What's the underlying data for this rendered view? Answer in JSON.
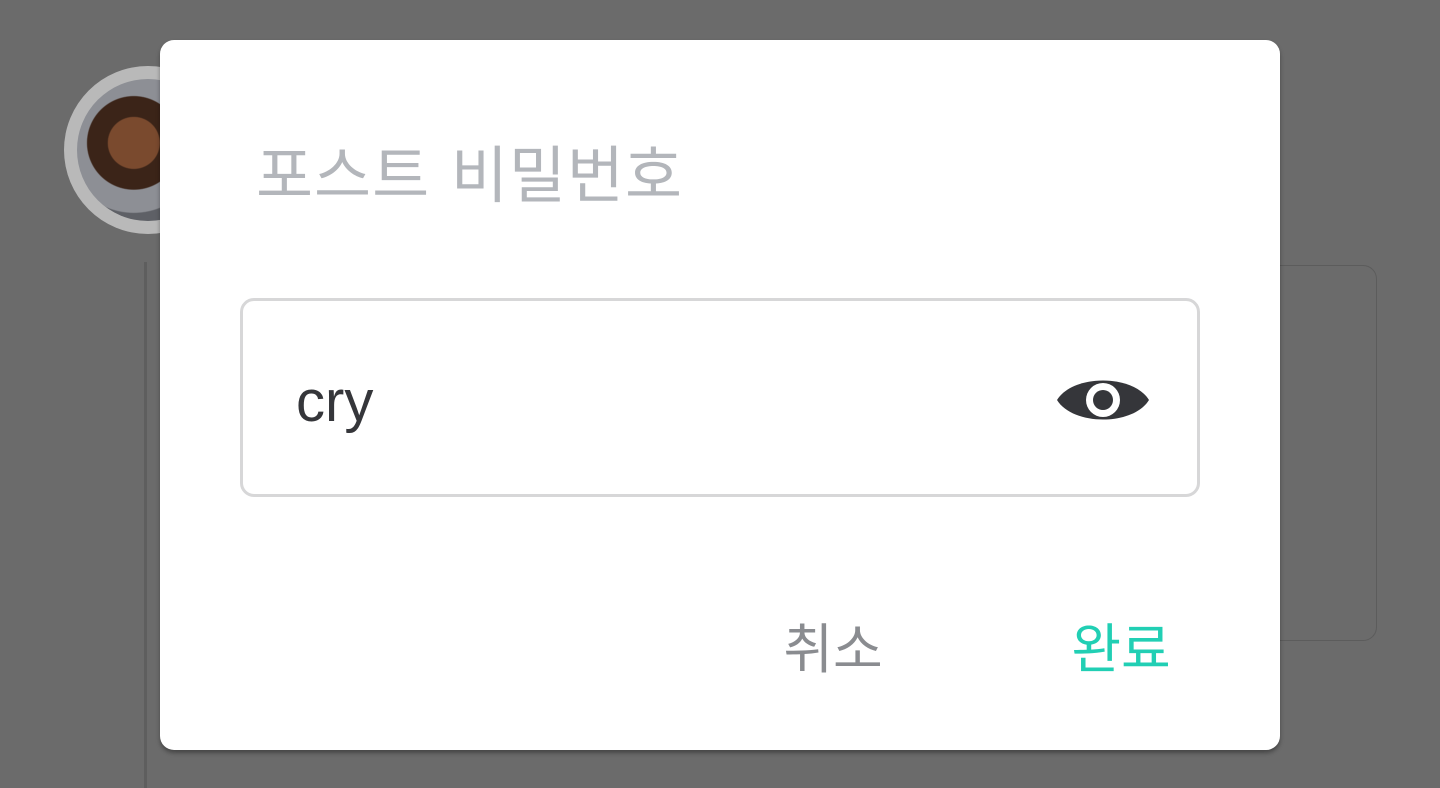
{
  "dialog": {
    "title": "포스트 비밀번호",
    "password_value": "cry",
    "visibility_icon": "eye-icon",
    "cancel_label": "취소",
    "done_label": "완료"
  },
  "colors": {
    "overlay": "#6b6b6b",
    "dialog_background": "#ffffff",
    "title": "#b3b6bb",
    "input_text": "#35363a",
    "input_border": "#d7d7d8",
    "cancel": "#8a8c90",
    "accent": "#21cfb4"
  }
}
